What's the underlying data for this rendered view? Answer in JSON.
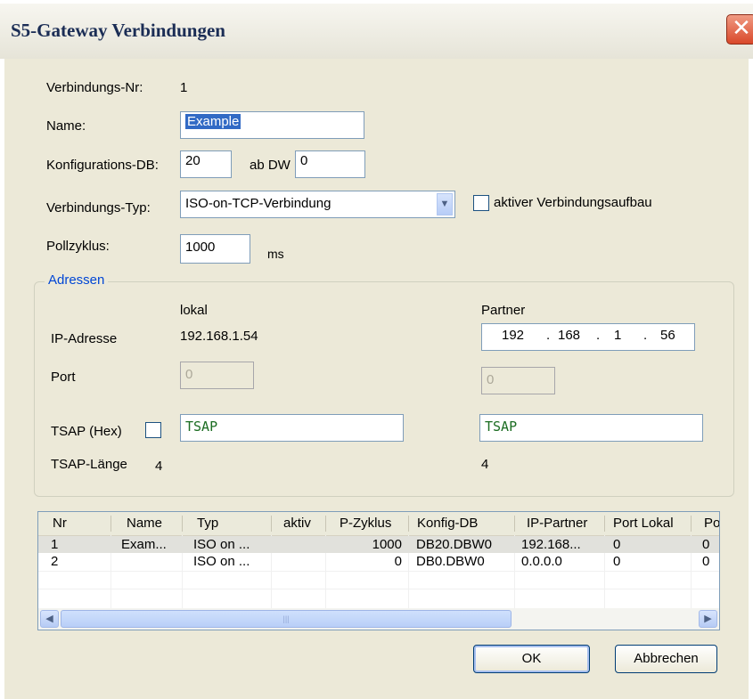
{
  "window": {
    "title": "S5-Gateway Verbindungen",
    "close_glyph": "✕"
  },
  "form": {
    "verbindungs_nr_label": "Verbindungs-Nr:",
    "verbindungs_nr_value": "1",
    "name_label": "Name:",
    "name_value": "Example",
    "konfig_db_label": "Konfigurations-DB:",
    "konfig_db_value": "20",
    "ab_dw_label": "ab DW",
    "ab_dw_value": "0",
    "typ_label": "Verbindungs-Typ:",
    "typ_value": "ISO-on-TCP-Verbindung",
    "aktiv_label": "aktiver Verbindungsaufbau",
    "aktiv_checked": false,
    "poll_label": "Pollzyklus:",
    "poll_value": "1000",
    "poll_unit": "ms"
  },
  "adressen": {
    "title": "Adressen",
    "lokal_label": "lokal",
    "partner_label": "Partner",
    "ip_label": "IP-Adresse",
    "ip_lokal": "192.168.1.54",
    "ip_partner": [
      "192",
      "168",
      "1",
      "56"
    ],
    "ip_dot": ".",
    "port_label": "Port",
    "port_lokal": "0",
    "port_partner": "0",
    "tsap_label": "TSAP (Hex)",
    "tsap_checked": false,
    "tsap_lokal": "TSAP",
    "tsap_partner": "TSAP",
    "tsap_len_label": "TSAP-Länge",
    "tsap_len_lokal": "4",
    "tsap_len_partner": "4"
  },
  "table": {
    "columns": [
      "Nr",
      "Name",
      "Typ",
      "aktiv",
      "P-Zyklus",
      "Konfig-DB",
      "IP-Partner",
      "Port Lokal",
      "Po"
    ],
    "rows": [
      [
        "1",
        "Exam...",
        "ISO on ...",
        "",
        "1000",
        "DB20.DBW0",
        "192.168...",
        "0",
        "0"
      ],
      [
        "2",
        "",
        "ISO on ...",
        "",
        "0",
        "DB0.DBW0",
        "0.0.0.0",
        "0",
        "0"
      ]
    ],
    "scroll_left": "◀",
    "scroll_right": "▶",
    "thumb_grip": "|||"
  },
  "buttons": {
    "ok": "OK",
    "cancel": "Abbrechen"
  },
  "colors": {
    "title_text": "#1b2d55",
    "group_title": "#0046d5",
    "selection": "#316ac5",
    "close": "#d9482a"
  }
}
